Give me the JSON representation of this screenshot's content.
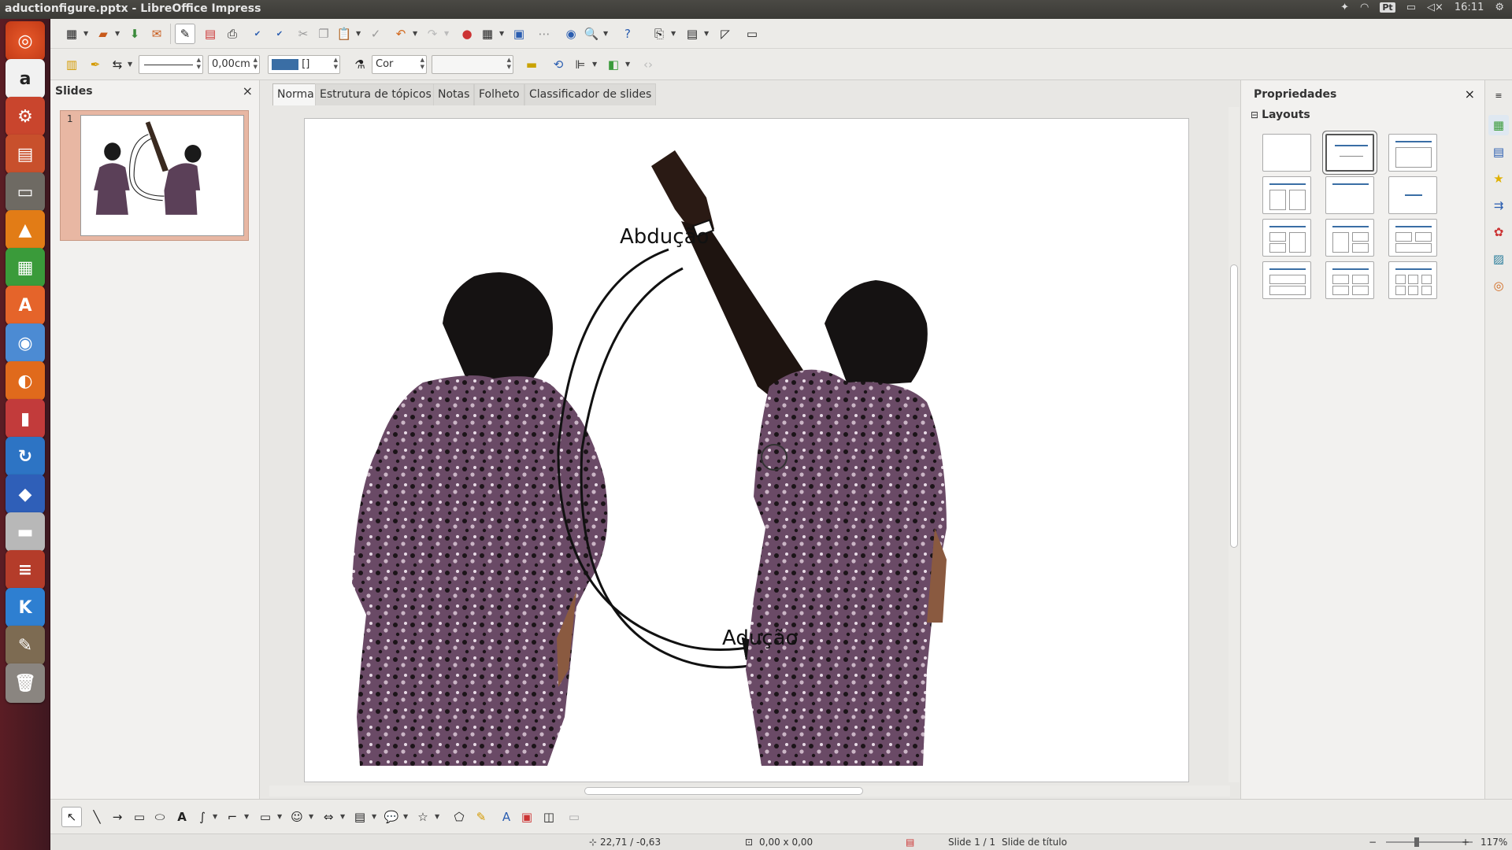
{
  "window": {
    "title": "aductionfigure.pptx - LibreOffice Impress"
  },
  "systray": {
    "keyboard": "Pt",
    "clock": "16:11"
  },
  "toolbar2": {
    "line_width": "0,00cm",
    "area_color_value": "[]",
    "area_style": "Cor",
    "area_fill": ""
  },
  "slides_pane": {
    "title": "Slides",
    "close": "×",
    "slide_number": "1"
  },
  "view_tabs": [
    "Normal",
    "Estrutura de tópicos",
    "Notas",
    "Folheto",
    "Classificador de slides"
  ],
  "slide": {
    "label_top": "Abdução",
    "label_bottom": "Adução"
  },
  "properties": {
    "title": "Propriedades",
    "close": "×",
    "section": "Layouts",
    "section_toggle": "⊟"
  },
  "status": {
    "position": "22,71 / -0,63",
    "size": "0,00 x 0,00",
    "slide": "Slide 1 / 1",
    "layout": "Slide de título",
    "zoom": "117%"
  },
  "colors": {
    "accent": "#3a6ea5",
    "launcher": "#4f1b22",
    "selection": "#e8b7a3"
  }
}
